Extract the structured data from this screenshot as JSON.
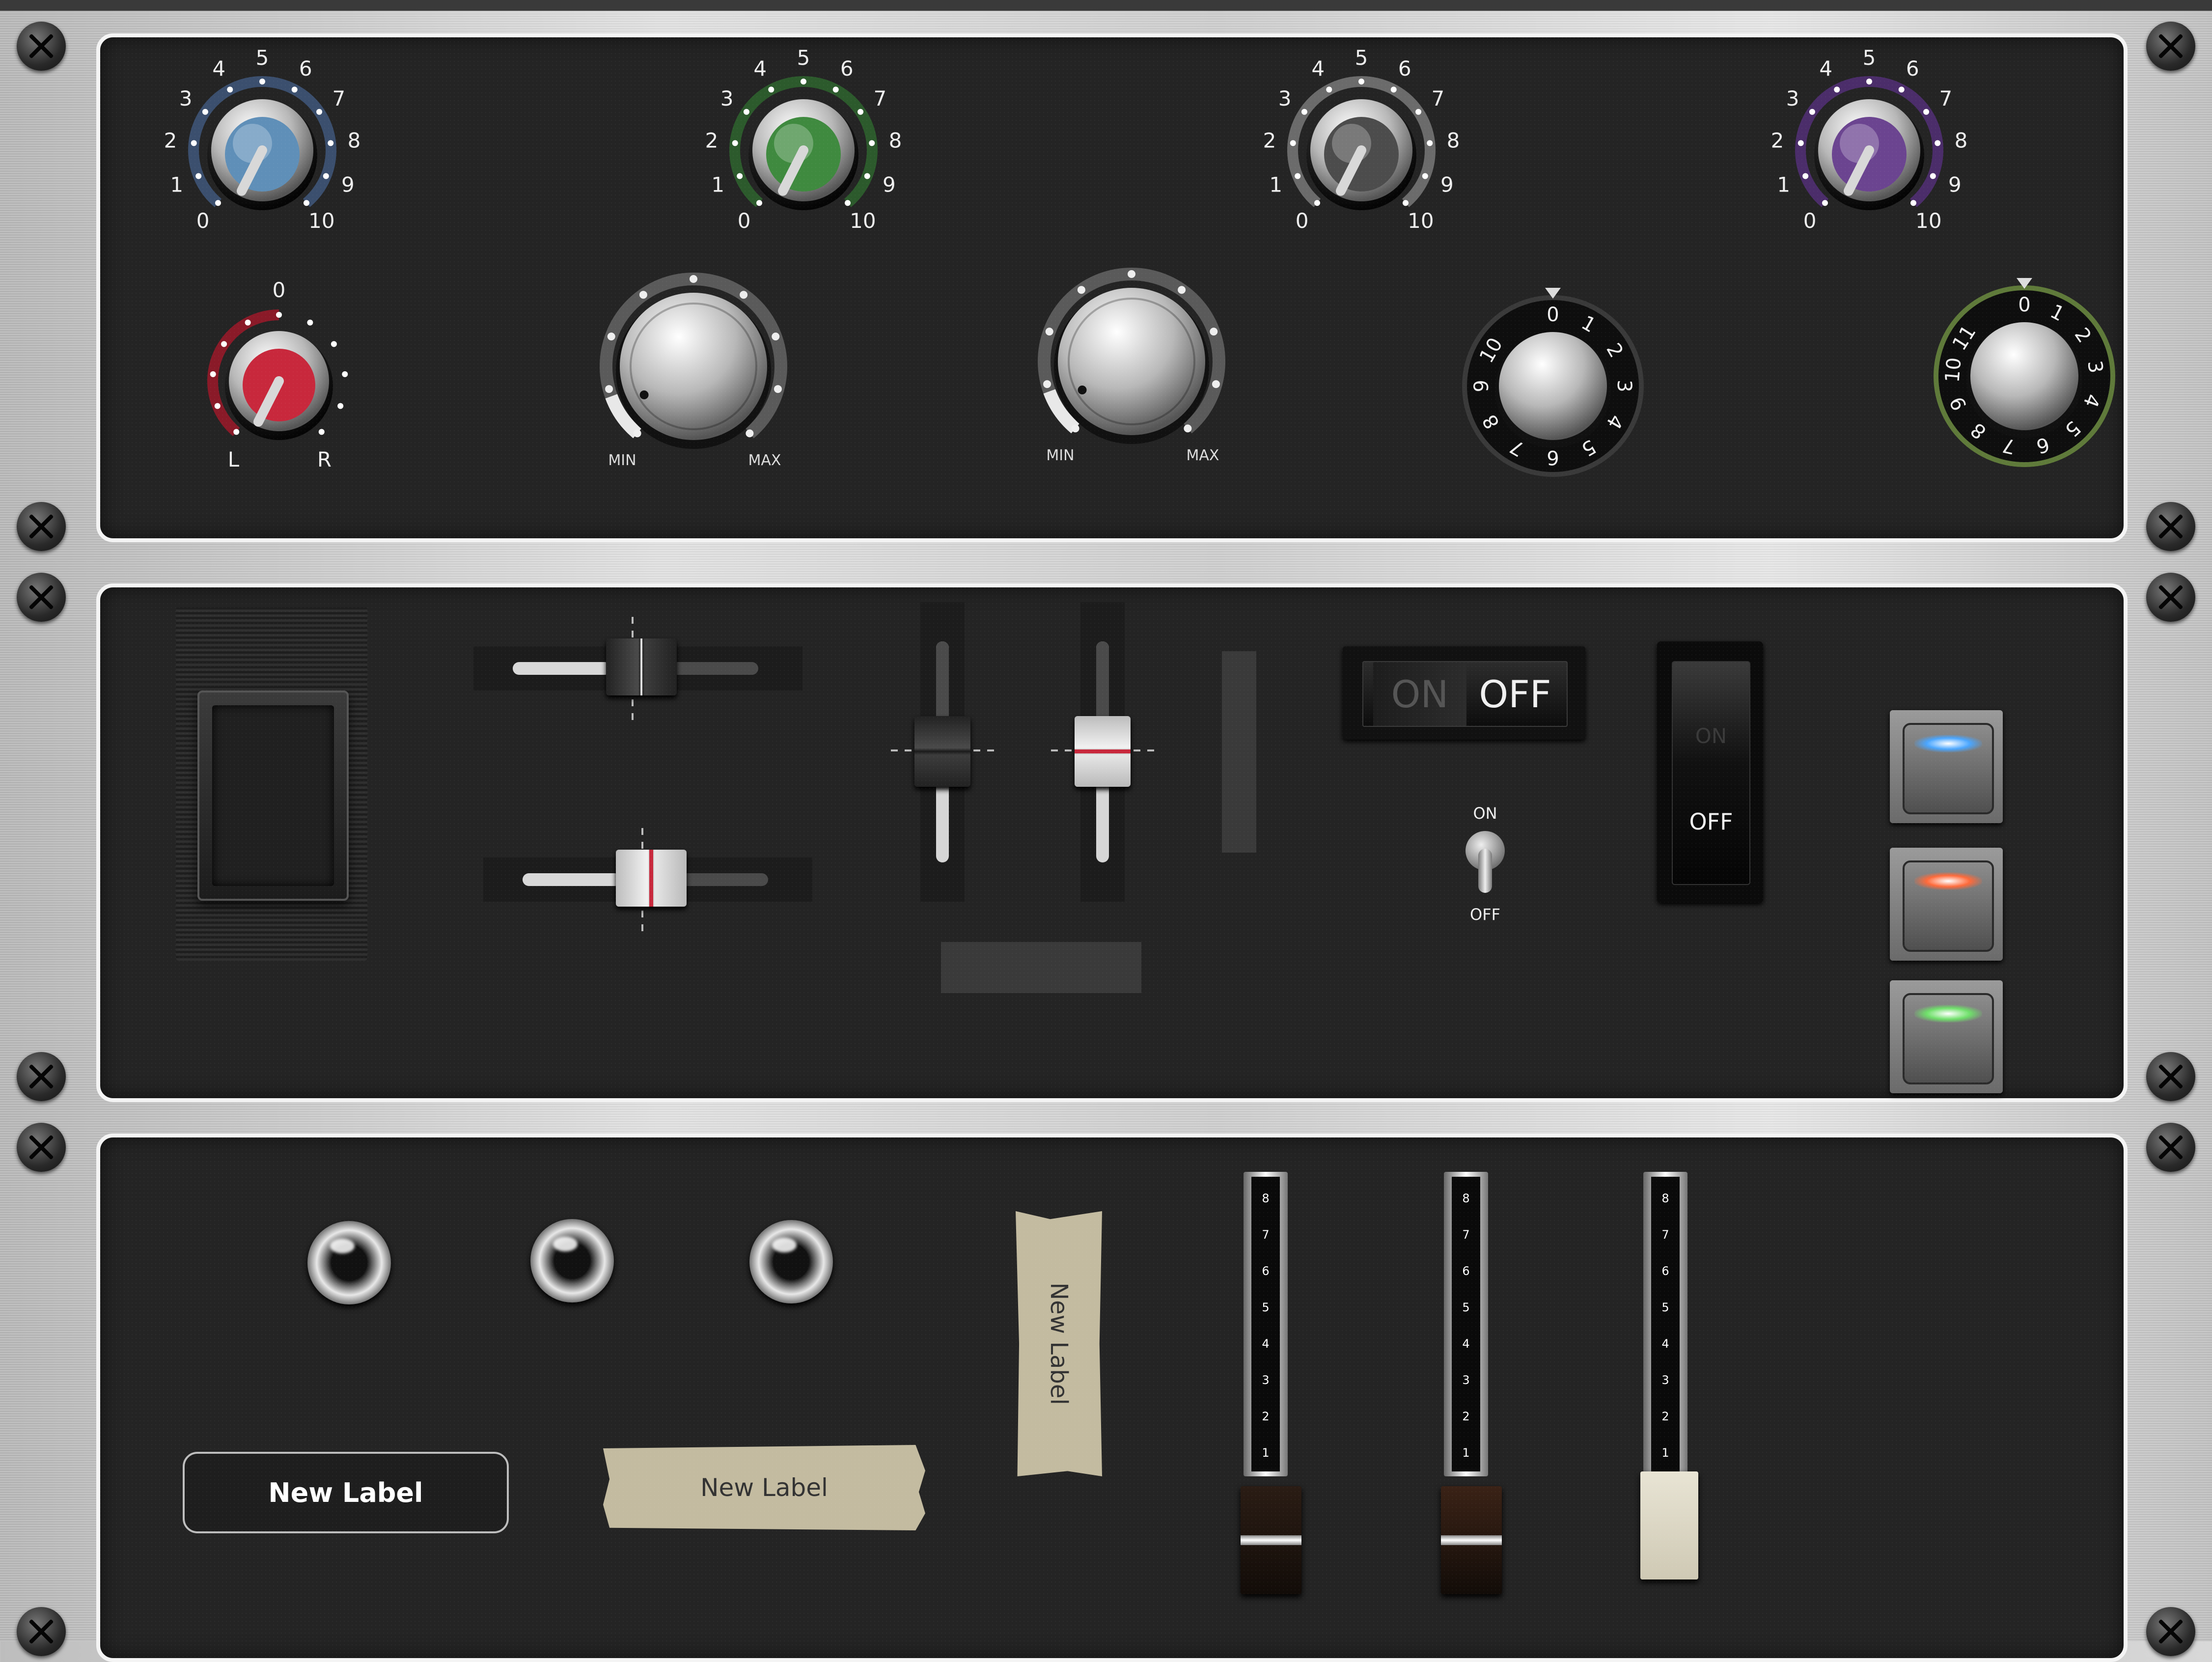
{
  "knob_row1": [
    {
      "scale": [
        "0",
        "1",
        "2",
        "3",
        "4",
        "5",
        "6",
        "7",
        "8",
        "9",
        "10"
      ],
      "color": "#5f8fb8",
      "ring": "#3b4f6e"
    },
    {
      "scale": [
        "0",
        "1",
        "2",
        "3",
        "4",
        "5",
        "6",
        "7",
        "8",
        "9",
        "10"
      ],
      "color": "#3f8a3f",
      "ring": "#2c5a2c"
    },
    {
      "scale": [
        "0",
        "1",
        "2",
        "3",
        "4",
        "5",
        "6",
        "7",
        "8",
        "9",
        "10"
      ],
      "color": "#4c4c4c",
      "ring": "#6b6b6b"
    },
    {
      "scale": [
        "0",
        "1",
        "2",
        "3",
        "4",
        "5",
        "6",
        "7",
        "8",
        "9",
        "10"
      ],
      "color": "#6b4490",
      "ring": "#4b2d6a"
    }
  ],
  "pan_knob": {
    "top": "0",
    "left": "L",
    "right": "R",
    "color": "#c8283c"
  },
  "range_knobs": [
    {
      "min": "MIN",
      "max": "MAX"
    },
    {
      "min": "MIN",
      "max": "MAX"
    }
  ],
  "dial_knobs": [
    {
      "numbers": [
        "0",
        "1",
        "2",
        "3",
        "4",
        "5",
        "6",
        "7",
        "8",
        "9",
        "10"
      ]
    },
    {
      "numbers": [
        "0",
        "1",
        "2",
        "3",
        "4",
        "5",
        "6",
        "7",
        "8",
        "9",
        "10",
        "11"
      ]
    }
  ],
  "switches": {
    "rocker_on": "ON",
    "rocker_off": "OFF",
    "toggle_on": "ON",
    "toggle_off": "OFF",
    "vertical_rocker_on": "ON",
    "vertical_rocker_off": "OFF"
  },
  "led_buttons": [
    {
      "color": "#4aa6ff"
    },
    {
      "color": "#ff6a3a"
    },
    {
      "color": "#6fe06a"
    }
  ],
  "labels": {
    "dark_label": "New Label",
    "tape_horizontal": "New Label",
    "tape_vertical": "New Label"
  },
  "fader_scale": [
    "8",
    "7",
    "6",
    "5",
    "4",
    "3",
    "2",
    "1"
  ]
}
